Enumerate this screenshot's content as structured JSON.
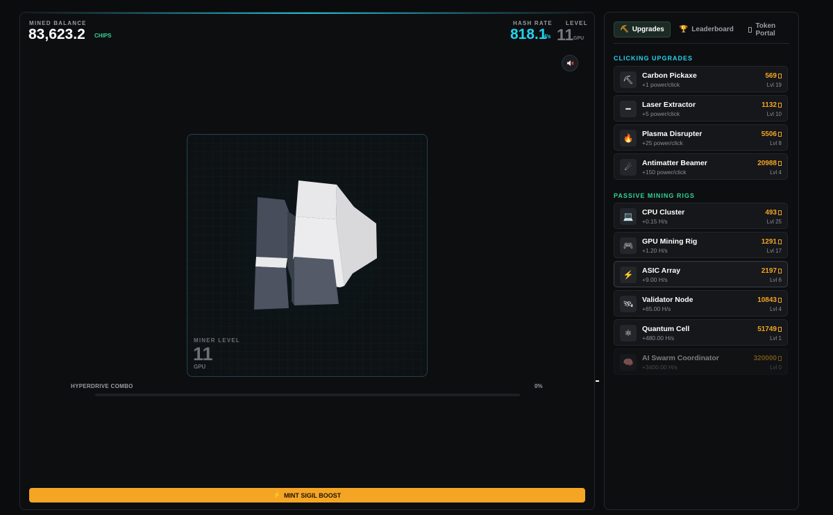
{
  "stats": {
    "balance_label": "MINED BALANCE",
    "balance_value": "83,623.2",
    "balance_unit": "CHIPS",
    "hash_label": "HASH RATE",
    "hash_value": "818.1",
    "hash_unit": "H/s",
    "level_label": "LEVEL",
    "level_value": "11",
    "level_unit": "GPU"
  },
  "stage": {
    "miner_level_label": "MINER LEVEL",
    "miner_level_value": "11",
    "miner_level_unit": "GPU"
  },
  "combo": {
    "label": "HYPERDRIVE COMBO",
    "percent_text": "0%",
    "fill_fraction": 0
  },
  "boost": {
    "label": "MINT SIGIL BOOST",
    "icon": "lightning-icon"
  },
  "tabs": [
    {
      "label": "Upgrades",
      "icon": "pickaxe-icon",
      "active": true
    },
    {
      "label": "Leaderboard",
      "icon": "trophy-icon",
      "active": false
    },
    {
      "label": "Token Portal",
      "icon": "box-icon",
      "active": false
    }
  ],
  "sections": {
    "clicking_title": "CLICKING UPGRADES",
    "passive_title": "PASSIVE MINING RIGS"
  },
  "clicking_upgrades": [
    {
      "name": "Carbon Pickaxe",
      "desc": "+1 power/click",
      "cost": "569",
      "level": "Lvl 19",
      "icon": "pickaxe-icon",
      "glyph": "⛏"
    },
    {
      "name": "Laser Extractor",
      "desc": "+5 power/click",
      "cost": "1132",
      "level": "Lvl 10",
      "icon": "laser-icon",
      "glyph": "━"
    },
    {
      "name": "Plasma Disrupter",
      "desc": "+25 power/click",
      "cost": "5506",
      "level": "Lvl 8",
      "icon": "fire-icon",
      "glyph": "🔥"
    },
    {
      "name": "Antimatter Beamer",
      "desc": "+150 power/click",
      "cost": "20988",
      "level": "Lvl 4",
      "icon": "comet-icon",
      "glyph": "☄"
    }
  ],
  "passive_rigs": [
    {
      "name": "CPU Cluster",
      "desc": "+0.15 H/s",
      "cost": "493",
      "level": "Lvl 25",
      "icon": "laptop-icon",
      "glyph": "💻"
    },
    {
      "name": "GPU Mining Rig",
      "desc": "+1.20 H/s",
      "cost": "1291",
      "level": "Lvl 17",
      "icon": "gamepad-icon",
      "glyph": "🎮"
    },
    {
      "name": "ASIC Array",
      "desc": "+9.00 H/s",
      "cost": "2197",
      "level": "Lvl 6",
      "icon": "lightning-icon",
      "glyph": "⚡"
    },
    {
      "name": "Validator Node",
      "desc": "+65.00 H/s",
      "cost": "10843",
      "level": "Lvl 4",
      "icon": "satellite-icon",
      "glyph": "🛰"
    },
    {
      "name": "Quantum Cell",
      "desc": "+480.00 H/s",
      "cost": "51749",
      "level": "Lvl 1",
      "icon": "atom-icon",
      "glyph": "⚛"
    },
    {
      "name": "AI Swarm Coordinator",
      "desc": "+3400.00 H/s",
      "cost": "320000",
      "level": "Lvl 0",
      "icon": "brain-icon",
      "glyph": "🧠"
    }
  ]
}
